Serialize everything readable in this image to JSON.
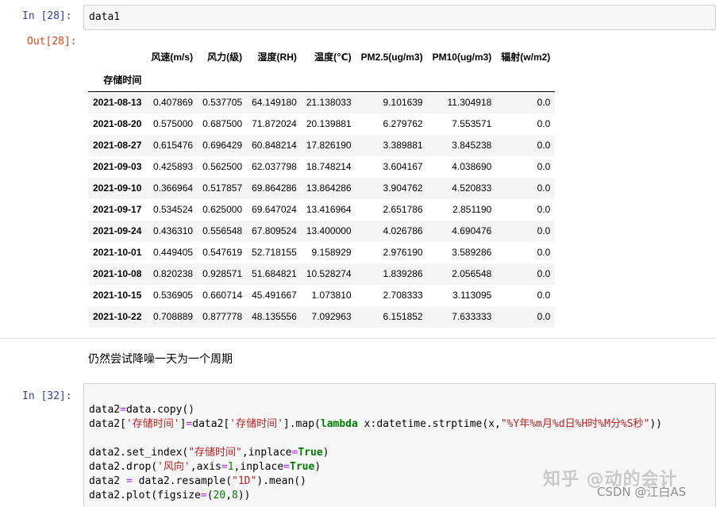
{
  "cell28": {
    "in_prompt": "In  [28]:",
    "code": "data1",
    "out_prompt": "Out[28]:"
  },
  "dataframe": {
    "columns": [
      "风速(m/s)",
      "风力(级)",
      "湿度(RH)",
      "温度(℃)",
      "PM2.5(ug/m3)",
      "PM10(ug/m3)",
      "辐射(w/m2)"
    ],
    "index_name": "存储时间",
    "rows": [
      {
        "index": "2021-08-13",
        "values": [
          "0.407869",
          "0.537705",
          "64.149180",
          "21.138033",
          "9.101639",
          "11.304918",
          "0.0"
        ]
      },
      {
        "index": "2021-08-20",
        "values": [
          "0.575000",
          "0.687500",
          "71.872024",
          "20.139881",
          "6.279762",
          "7.553571",
          "0.0"
        ]
      },
      {
        "index": "2021-08-27",
        "values": [
          "0.615476",
          "0.696429",
          "60.848214",
          "17.826190",
          "3.389881",
          "3.845238",
          "0.0"
        ]
      },
      {
        "index": "2021-09-03",
        "values": [
          "0.425893",
          "0.562500",
          "62.037798",
          "18.748214",
          "3.604167",
          "4.038690",
          "0.0"
        ]
      },
      {
        "index": "2021-09-10",
        "values": [
          "0.366964",
          "0.517857",
          "69.864286",
          "13.864286",
          "3.904762",
          "4.520833",
          "0.0"
        ]
      },
      {
        "index": "2021-09-17",
        "values": [
          "0.534524",
          "0.625000",
          "69.647024",
          "13.416964",
          "2.651786",
          "2.851190",
          "0.0"
        ]
      },
      {
        "index": "2021-09-24",
        "values": [
          "0.436310",
          "0.556548",
          "67.809524",
          "13.400000",
          "4.026786",
          "4.690476",
          "0.0"
        ]
      },
      {
        "index": "2021-10-01",
        "values": [
          "0.449405",
          "0.547619",
          "52.718155",
          "9.158929",
          "2.976190",
          "3.589286",
          "0.0"
        ]
      },
      {
        "index": "2021-10-08",
        "values": [
          "0.820238",
          "0.928571",
          "51.684821",
          "10.528274",
          "1.839286",
          "2.056548",
          "0.0"
        ]
      },
      {
        "index": "2021-10-15",
        "values": [
          "0.536905",
          "0.660714",
          "45.491667",
          "1.073810",
          "2.708333",
          "3.113095",
          "0.0"
        ]
      },
      {
        "index": "2021-10-22",
        "values": [
          "0.708889",
          "0.877778",
          "48.135556",
          "7.092963",
          "6.151852",
          "7.633333",
          "0.0"
        ]
      }
    ]
  },
  "markdown_text": "仍然尝试降噪一天为一个周期",
  "cell32": {
    "in_prompt": "In  [32]:",
    "lines": [
      [
        {
          "t": "data2"
        },
        {
          "t": "=",
          "c": "eq"
        },
        {
          "t": "data.copy()"
        }
      ],
      [
        {
          "t": "data2["
        },
        {
          "t": "'存储时间'",
          "c": "str"
        },
        {
          "t": "]"
        },
        {
          "t": "=",
          "c": "eq"
        },
        {
          "t": "data2["
        },
        {
          "t": "'存储时间'",
          "c": "str"
        },
        {
          "t": "].map("
        },
        {
          "t": "lambda",
          "c": "kw"
        },
        {
          "t": " x:datetime.strptime(x,"
        },
        {
          "t": "\"%Y年%m月%d日%H时%M分%S秒\"",
          "c": "str"
        },
        {
          "t": "))"
        }
      ],
      [
        {
          "t": ""
        }
      ],
      [
        {
          "t": "data2.set_index("
        },
        {
          "t": "\"存储时间\"",
          "c": "str"
        },
        {
          "t": ",inplace"
        },
        {
          "t": "=",
          "c": "eq"
        },
        {
          "t": "True",
          "c": "kw"
        },
        {
          "t": ")"
        }
      ],
      [
        {
          "t": "data2.drop("
        },
        {
          "t": "'风向'",
          "c": "str"
        },
        {
          "t": ",axis"
        },
        {
          "t": "=",
          "c": "eq"
        },
        {
          "t": "1",
          "c": "num"
        },
        {
          "t": ",inplace"
        },
        {
          "t": "=",
          "c": "eq"
        },
        {
          "t": "True",
          "c": "kw"
        },
        {
          "t": ")"
        }
      ],
      [
        {
          "t": "data2 "
        },
        {
          "t": "=",
          "c": "eq"
        },
        {
          "t": " data2.resample("
        },
        {
          "t": "\"1D\"",
          "c": "str"
        },
        {
          "t": ").mean()"
        }
      ],
      [
        {
          "t": "data2.plot(figsize"
        },
        {
          "t": "=",
          "c": "eq"
        },
        {
          "t": "("
        },
        {
          "t": "20",
          "c": "num"
        },
        {
          "t": ","
        },
        {
          "t": "8",
          "c": "num"
        },
        {
          "t": "))"
        }
      ]
    ]
  },
  "watermark": {
    "zhihu": "知乎 @动的会计",
    "csdn": "CSDN @江白AS"
  }
}
